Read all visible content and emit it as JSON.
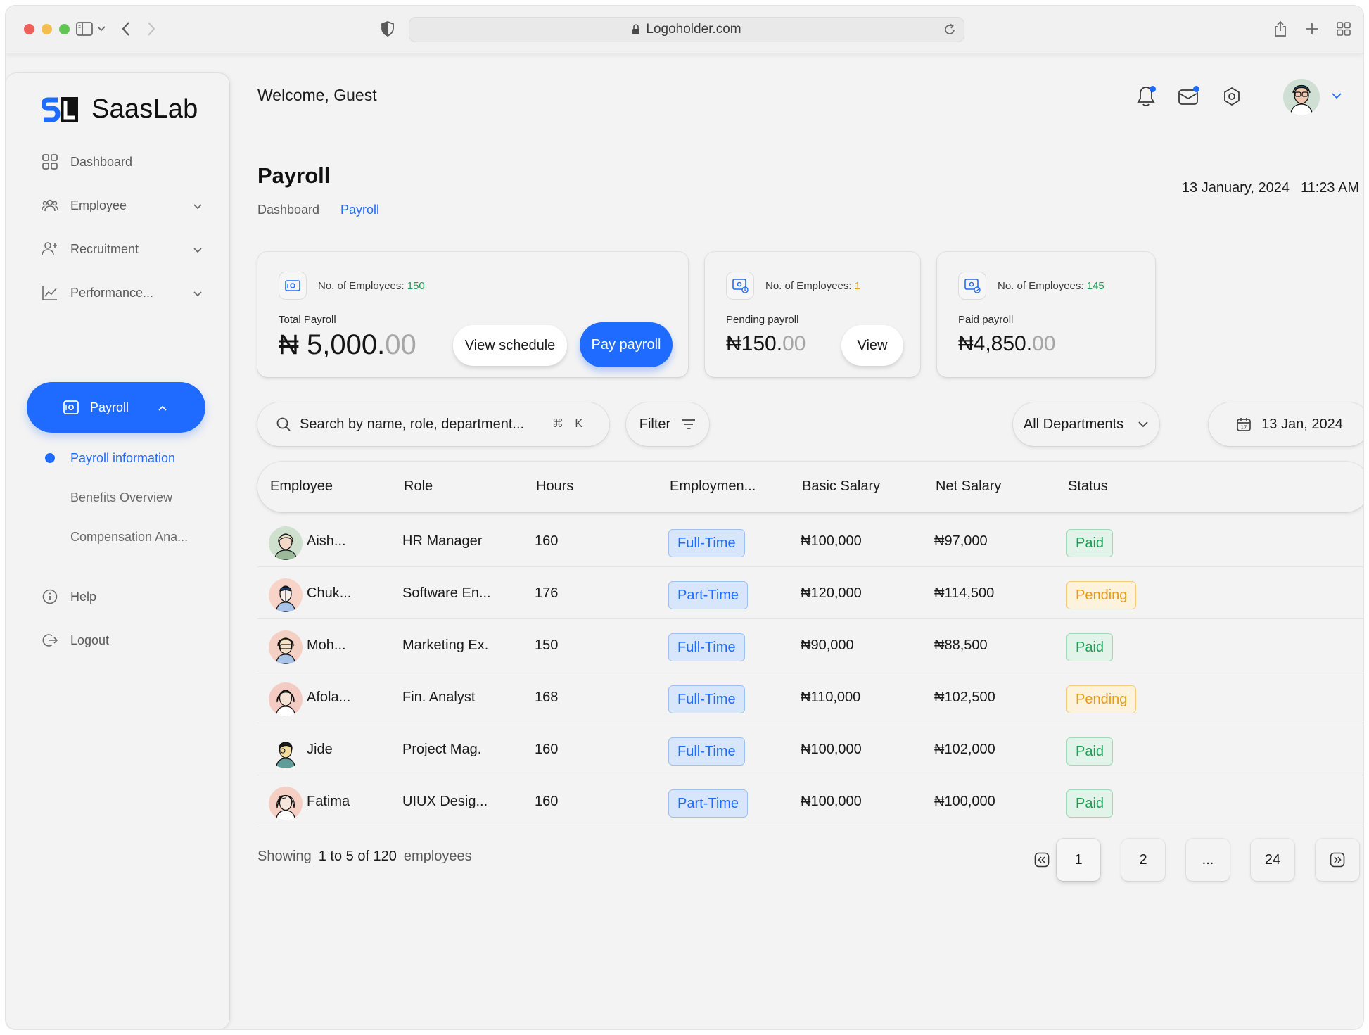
{
  "browser": {
    "url": "Logoholder.com"
  },
  "sidebar": {
    "logo_text": "SaasLab",
    "items": [
      {
        "label": "Dashboard"
      },
      {
        "label": "Employee"
      },
      {
        "label": "Recruitment"
      },
      {
        "label": "Performance..."
      },
      {
        "label": "Payroll"
      },
      {
        "label": "Help"
      },
      {
        "label": "Logout"
      }
    ],
    "payroll_sub": [
      {
        "label": "Payroll information"
      },
      {
        "label": "Benefits Overview"
      },
      {
        "label": "Compensation Ana..."
      }
    ]
  },
  "header": {
    "welcome_prefix": "Welcome,",
    "user_name": "Guest"
  },
  "page": {
    "title": "Payroll",
    "breadcrumb": [
      "Dashboard",
      "Payroll"
    ],
    "date": "13 January, 2024",
    "time": "11:23 AM"
  },
  "cards": [
    {
      "count_label": "No. of Employees:",
      "count": "150",
      "label": "Total Payroll",
      "amount_main": "₦ 5,000.",
      "amount_cents": "00",
      "buttons": [
        "View schedule",
        "Pay payroll"
      ]
    },
    {
      "count_label": "No. of Employees:",
      "count": "1",
      "label": "Pending payroll",
      "amount_main": "₦150.",
      "amount_cents": "00",
      "button": "View"
    },
    {
      "count_label": "No. of Employees:",
      "count": "145",
      "label": "Paid payroll",
      "amount_main": "₦4,850.",
      "amount_cents": "00"
    }
  ],
  "toolbar": {
    "search_placeholder": "Search by name, role, department...",
    "shortcut": "⌘ K",
    "filter_label": "Filter",
    "department": "All Departments",
    "date": "13 Jan, 2024"
  },
  "table": {
    "headers": [
      "Employee",
      "Role",
      "Hours",
      "Employmen...",
      "Basic Salary",
      "Net Salary",
      "Status"
    ],
    "rows": [
      {
        "name": "Aish...",
        "role": "HR Manager",
        "hours": "160",
        "type": "Full-Time",
        "basic": "₦100,000",
        "net": "₦97,000",
        "status": "Paid"
      },
      {
        "name": "Chuk...",
        "role": "Software En...",
        "hours": "176",
        "type": "Part-Time",
        "basic": "₦120,000",
        "net": "₦114,500",
        "status": "Pending"
      },
      {
        "name": "Moh...",
        "role": "Marketing Ex.",
        "hours": "150",
        "type": "Full-Time",
        "basic": "₦90,000",
        "net": "₦88,500",
        "status": "Paid"
      },
      {
        "name": "Afola...",
        "role": "Fin. Analyst",
        "hours": "168",
        "type": "Full-Time",
        "basic": "₦110,000",
        "net": "₦102,500",
        "status": "Pending"
      },
      {
        "name": "Jide",
        "role": "Project Mag.",
        "hours": "160",
        "type": "Full-Time",
        "basic": "₦100,000",
        "net": "₦102,000",
        "status": "Paid"
      },
      {
        "name": "Fatima",
        "role": "UIUX Desig...",
        "hours": "160",
        "type": "Part-Time",
        "basic": "₦100,000",
        "net": "₦100,000",
        "status": "Paid"
      }
    ]
  },
  "pagination": {
    "showing_prefix": "Showing",
    "range": "1 to 5 of 120",
    "suffix": "employees",
    "pages": [
      "1",
      "2",
      "...",
      "24"
    ]
  },
  "colors": {
    "accent": "#1f6bff",
    "paid": "#1f9d55",
    "pending": "#e49b16"
  }
}
